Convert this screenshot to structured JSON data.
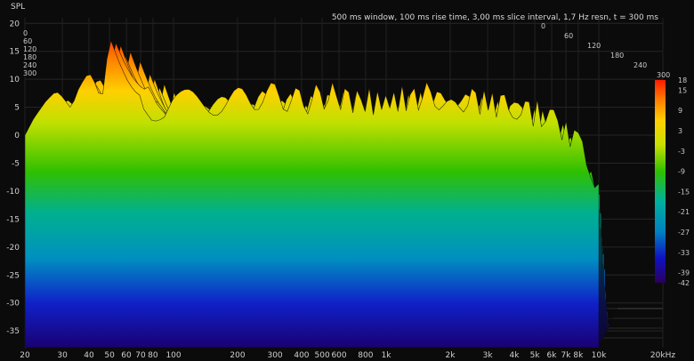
{
  "chart_data": {
    "type": "area",
    "title": "500 ms window, 100 ms rise time, 3,00 ms slice interval, 1,7 Hz resn, t = 300 ms",
    "ylabel": "SPL",
    "x_ticks": [
      "20",
      "30",
      "40",
      "50",
      "60",
      "70",
      "80",
      "100",
      "200",
      "300",
      "400",
      "500",
      "600",
      "800",
      "1k",
      "2k",
      "3k",
      "4k",
      "5k",
      "6k",
      "7k",
      "8k",
      "10k",
      "20kHz"
    ],
    "x_tick_values": [
      20,
      30,
      40,
      50,
      60,
      70,
      80,
      100,
      200,
      300,
      400,
      500,
      600,
      800,
      1000,
      2000,
      3000,
      4000,
      5000,
      6000,
      7000,
      8000,
      10000,
      20000
    ],
    "y_ticks": [
      "20",
      "15",
      "10",
      "5",
      "0",
      "-5",
      "-10",
      "-15",
      "-20",
      "-25",
      "-30",
      "-35"
    ],
    "y_tick_values": [
      20,
      15,
      10,
      5,
      0,
      -5,
      -10,
      -15,
      -20,
      -25,
      -30,
      -35
    ],
    "ylim": [
      -38,
      21
    ],
    "xlim": [
      20,
      20000
    ],
    "time_ticks": [
      "0",
      "60",
      "120",
      "180",
      "240",
      "300"
    ],
    "time_tick_values": [
      0,
      60,
      120,
      180,
      240,
      300
    ],
    "color_scale": {
      "ticks": [
        "18",
        "15",
        "9",
        "3",
        "-3",
        "-9",
        "-15",
        "-21",
        "-27",
        "-33",
        "-39",
        "-42"
      ],
      "values": [
        18,
        15,
        9,
        3,
        -3,
        -9,
        -15,
        -21,
        -27,
        -33,
        -39,
        -42
      ],
      "range": [
        -42,
        18
      ]
    },
    "front_slice": {
      "freqs": [
        20,
        22,
        25,
        28,
        30,
        33,
        36,
        40,
        43,
        46,
        50,
        55,
        60,
        65,
        70,
        75,
        80,
        90,
        100,
        120,
        150,
        200,
        250,
        300,
        400,
        500,
        600,
        800,
        1000,
        1500,
        2000,
        3000,
        4000,
        5000,
        6000,
        7000,
        8000,
        9000,
        10000
      ],
      "spl": [
        -1,
        2,
        5,
        7,
        6,
        4,
        8,
        11,
        9,
        6,
        18,
        14,
        11,
        9,
        8,
        6,
        4,
        3,
        5,
        6,
        6,
        6,
        7,
        7,
        6,
        7,
        7,
        6,
        6,
        7,
        7,
        6,
        5,
        4,
        3,
        1,
        -2,
        -6,
        -10
      ]
    },
    "grid": true
  }
}
